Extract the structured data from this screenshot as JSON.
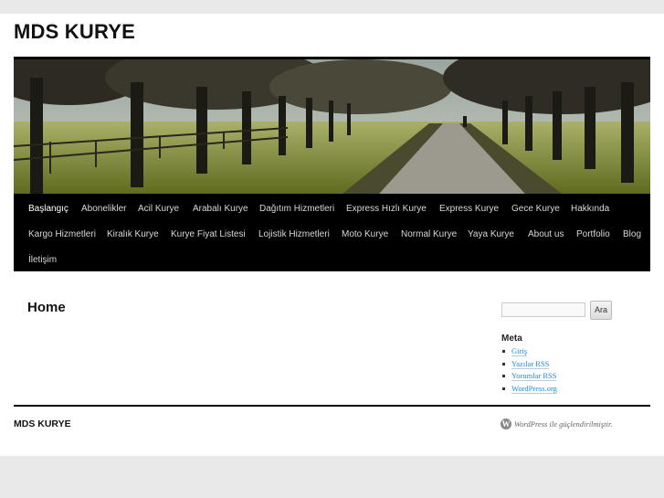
{
  "site": {
    "title": "MDS KURYE"
  },
  "header": {
    "banner_icon": "tree-lined-road-photo"
  },
  "nav": {
    "items": [
      {
        "label": "Başlangıç",
        "current": true
      },
      {
        "label": "Abonelikler"
      },
      {
        "label": "Acil Kurye"
      },
      {
        "label": "Arabalı Kurye"
      },
      {
        "label": "Dağıtım Hizmetleri"
      },
      {
        "label": "Express Hızlı Kurye"
      },
      {
        "label": "Express Kurye"
      },
      {
        "label": "Gece Kurye"
      },
      {
        "label": "Hakkında"
      },
      {
        "label": "Kargo Hizmetleri"
      },
      {
        "label": "Kiralık Kurye"
      },
      {
        "label": "Kurye Fiyat Listesi"
      },
      {
        "label": "Lojistik Hizmetleri"
      },
      {
        "label": "Moto Kurye"
      },
      {
        "label": "Normal Kurye"
      },
      {
        "label": "Yaya Kurye"
      },
      {
        "label": "About us"
      },
      {
        "label": "Portfolio"
      },
      {
        "label": "Blog"
      },
      {
        "label": "İletişim"
      }
    ]
  },
  "main": {
    "heading": "Home"
  },
  "sidebar": {
    "search": {
      "value": "",
      "placeholder": "",
      "button_label": "Ara"
    },
    "meta": {
      "title": "Meta",
      "links": [
        "Giriş",
        "Yazılar RSS",
        "Yorumlar RSS",
        "WordPress.org"
      ]
    }
  },
  "footer": {
    "site_title": "MDS KURYE",
    "wp_icon": "wordpress-logo-icon",
    "powered_by": "WordPress ile güçlendirilmiştir."
  },
  "colors": {
    "nav_bg": "#000000",
    "link": "#1b8be0",
    "page_bg": "#e9e9e9"
  }
}
